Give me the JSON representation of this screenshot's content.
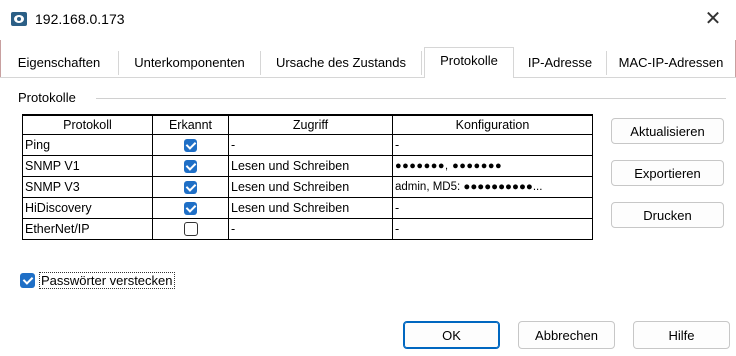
{
  "window": {
    "title": "192.168.0.173",
    "close_label": "✕"
  },
  "tabs": [
    {
      "label": "Eigenschaften",
      "active": false
    },
    {
      "label": "Unterkomponenten",
      "active": false
    },
    {
      "label": "Ursache des Zustands",
      "active": false
    },
    {
      "label": "Protokolle",
      "active": true
    },
    {
      "label": "IP-Adresse",
      "active": false
    },
    {
      "label": "MAC-IP-Adressen",
      "active": false
    }
  ],
  "group": {
    "label": "Protokolle"
  },
  "table": {
    "headers": [
      "Protokoll",
      "Erkannt",
      "Zugriff",
      "Konfiguration"
    ],
    "rows": [
      {
        "protocol": "Ping",
        "detected": true,
        "access": "-",
        "config": "-"
      },
      {
        "protocol": "SNMP V1",
        "detected": true,
        "access": "Lesen und Schreiben",
        "config": "●●●●●●●, ●●●●●●●"
      },
      {
        "protocol": "SNMP V3",
        "detected": true,
        "access": "Lesen und Schreiben",
        "config": "admin, MD5: ●●●●●●●●●●..."
      },
      {
        "protocol": "HiDiscovery",
        "detected": true,
        "access": "Lesen und Schreiben",
        "config": "-"
      },
      {
        "protocol": "EtherNet/IP",
        "detected": false,
        "access": "-",
        "config": "-"
      }
    ]
  },
  "side_buttons": {
    "refresh": "Aktualisieren",
    "export": "Exportieren",
    "print": "Drucken"
  },
  "hide_passwords": {
    "label": "Passwörter verstecken",
    "checked": true
  },
  "footer_buttons": {
    "ok": "OK",
    "cancel": "Abbrechen",
    "help": "Hilfe"
  },
  "colors": {
    "accent": "#1f6fc6",
    "default_button_border": "#0067c0"
  }
}
